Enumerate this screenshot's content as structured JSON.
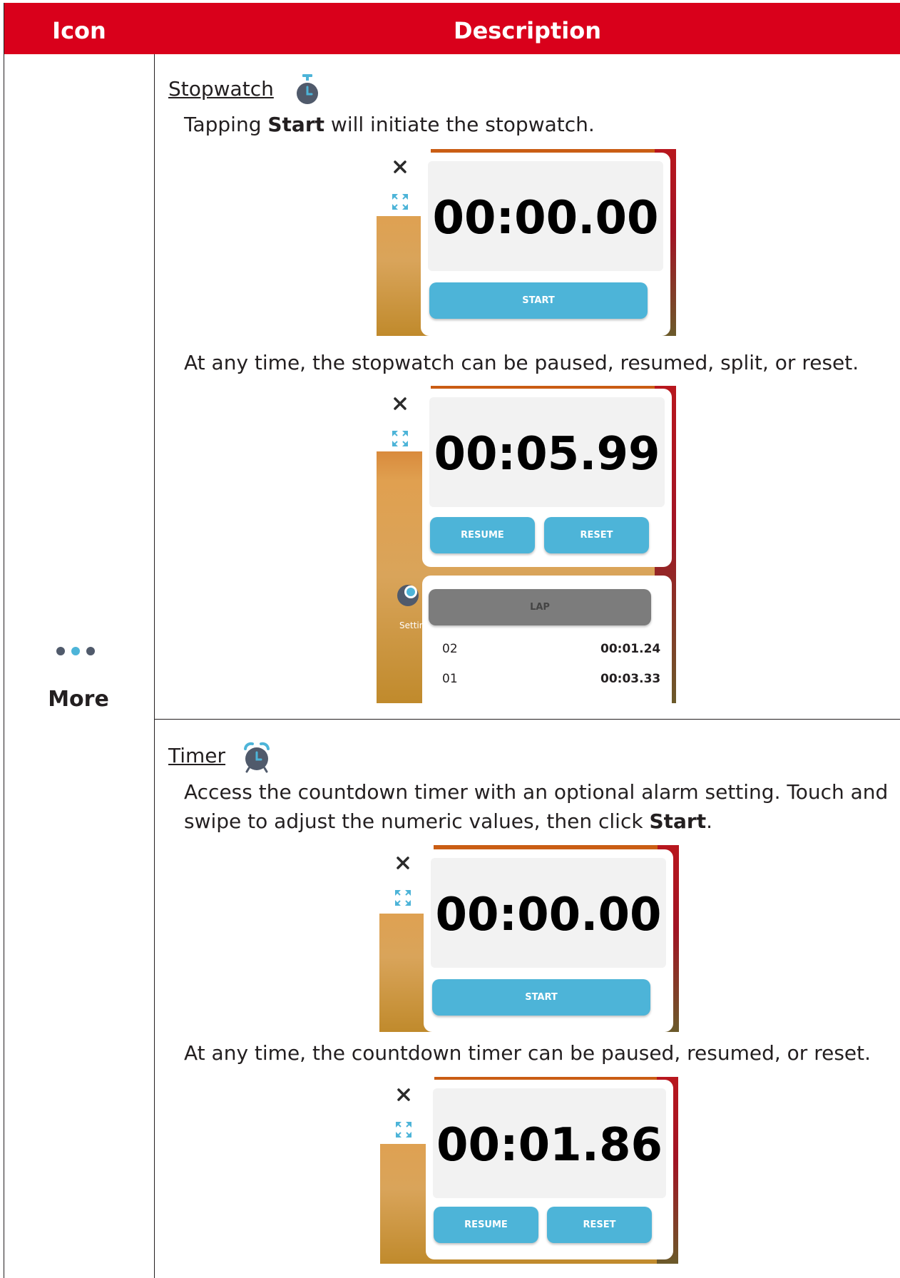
{
  "table": {
    "header": {
      "icon_col": "Icon",
      "description_col": "Description"
    },
    "icon_cell": {
      "label": "More"
    }
  },
  "stopwatch": {
    "title": "Stopwatch",
    "intro": {
      "before": "Tapping ",
      "bold": "Start",
      "after": " will initiate the stopwatch."
    },
    "shot1": {
      "time": "00:00.00",
      "start_label": "START"
    },
    "note": "At any time, the stopwatch can be paused, resumed, split, or reset.",
    "shot2": {
      "time": "00:05.99",
      "resume_label": "RESUME",
      "reset_label": "RESET",
      "lap_label": "LAP",
      "background_label": "Settin",
      "laps": [
        {
          "index": "02",
          "time": "00:01.24"
        },
        {
          "index": "01",
          "time": "00:03.33"
        }
      ]
    }
  },
  "timer": {
    "title": "Timer",
    "intro_line1": "Access the countdown timer with an optional alarm setting. Touch and",
    "intro_line2": {
      "before": "swipe to adjust the numeric values, then click ",
      "bold": "Start",
      "after": "."
    },
    "shot1": {
      "time": "00:00.00",
      "start_label": "START"
    },
    "note": "At any time, the countdown timer can be paused, resumed, or reset.",
    "shot2": {
      "time": "00:01.86",
      "resume_label": "RESUME",
      "reset_label": "RESET"
    }
  },
  "colors": {
    "header_red": "#d9001b",
    "button_blue": "#4db4d8",
    "dot_dark": "#505a6b",
    "dot_blue": "#4db4d8"
  },
  "icons": [
    "close-icon",
    "expand-icon",
    "stopwatch-icon",
    "alarm-clock-icon",
    "more-dots-icon"
  ]
}
